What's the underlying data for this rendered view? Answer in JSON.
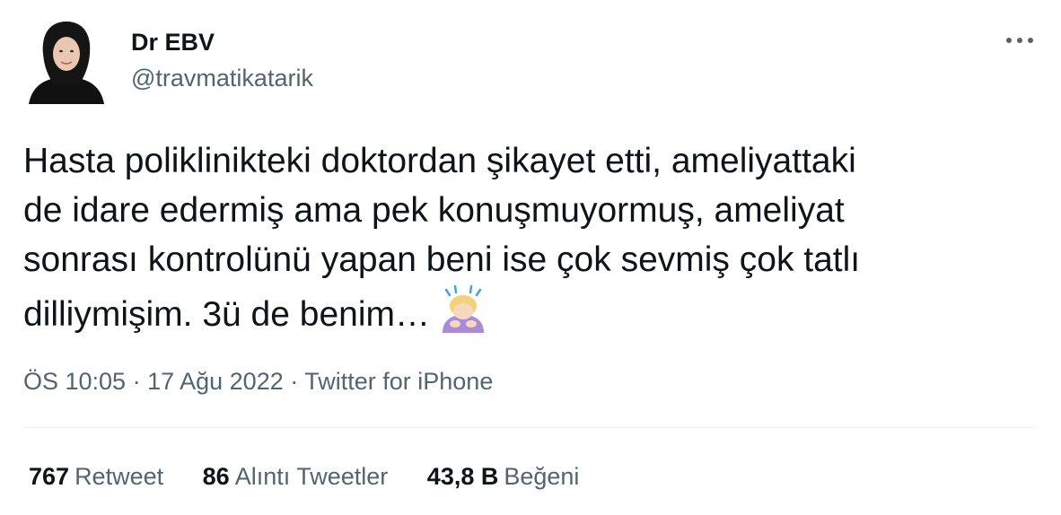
{
  "user": {
    "display_name": "Dr EBV",
    "handle": "@travmatikatarik",
    "avatar_icon": "profile-photo-avatar"
  },
  "more_icon": "more-dots-icon",
  "tweet": {
    "text": "Hasta poliklinikteki doktordan şikayet etti, ameliyattaki\nde idare edermiş ama pek konuşmuyormuş, ameliyat\nsonrası kontrolünü yapan beni ise çok sevmiş çok tatlı\ndilliymişim. 3ü de benim…",
    "emoji": "woman-bowing-emoji"
  },
  "meta": {
    "time": "ÖS 10:05",
    "sep1": " · ",
    "date": "17 Ağu 2022",
    "sep2": " · ",
    "source": "Twitter for iPhone"
  },
  "stats": [
    {
      "count": "767",
      "label": "Retweet"
    },
    {
      "count": "86",
      "label": "Alıntı Tweetler"
    },
    {
      "count": "43,8 B",
      "label": "Beğeni"
    }
  ],
  "colors": {
    "text": "#0f1419",
    "secondary": "#536471",
    "divider": "#eff3f4"
  }
}
